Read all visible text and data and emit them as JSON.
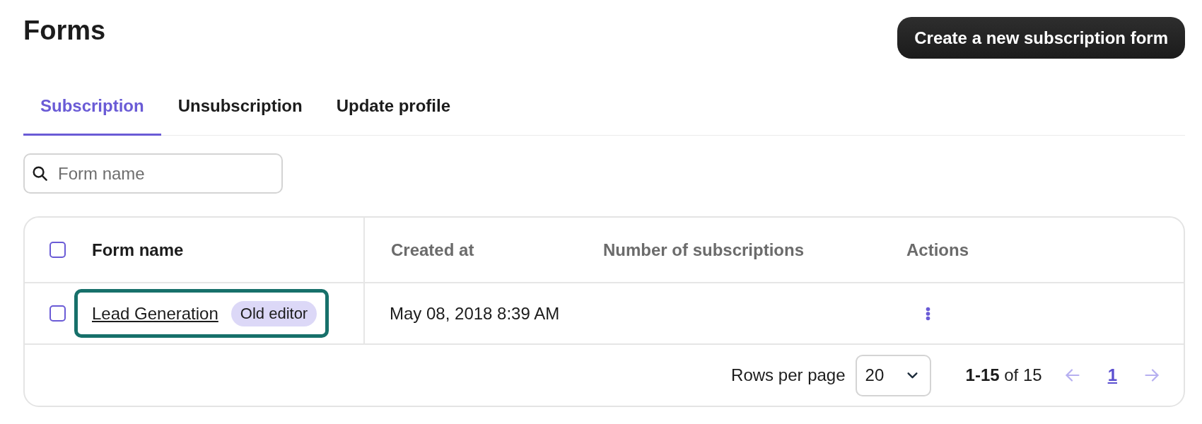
{
  "page": {
    "title": "Forms"
  },
  "primary_button": {
    "label": "Create a new subscription form"
  },
  "tabs": [
    {
      "label": "Subscription",
      "selected": true
    },
    {
      "label": "Unsubscription",
      "selected": false
    },
    {
      "label": "Update profile",
      "selected": false
    }
  ],
  "search": {
    "placeholder": "Form name"
  },
  "table": {
    "select_all": {
      "checked": false
    },
    "columns": [
      {
        "label": "Form name",
        "active": true
      },
      {
        "label": "Created at",
        "active": false
      },
      {
        "label": "Number of subscriptions",
        "active": false
      },
      {
        "label": "Actions",
        "active": false
      }
    ],
    "rows": [
      {
        "checked": false,
        "highlighted": true,
        "form_name": "Lead Generation",
        "badge": "Old editor",
        "created_at": "May 08, 2018 8:39 AM"
      }
    ]
  },
  "pagination": {
    "rows_per_page_label": "Rows per page",
    "rows_per_page": "20",
    "range": "**1-15** of 15",
    "previous": {
      "disabled": true
    },
    "next": {
      "disabled": true
    },
    "pages": [
      {
        "label": "1",
        "selected": true
      }
    ]
  }
}
